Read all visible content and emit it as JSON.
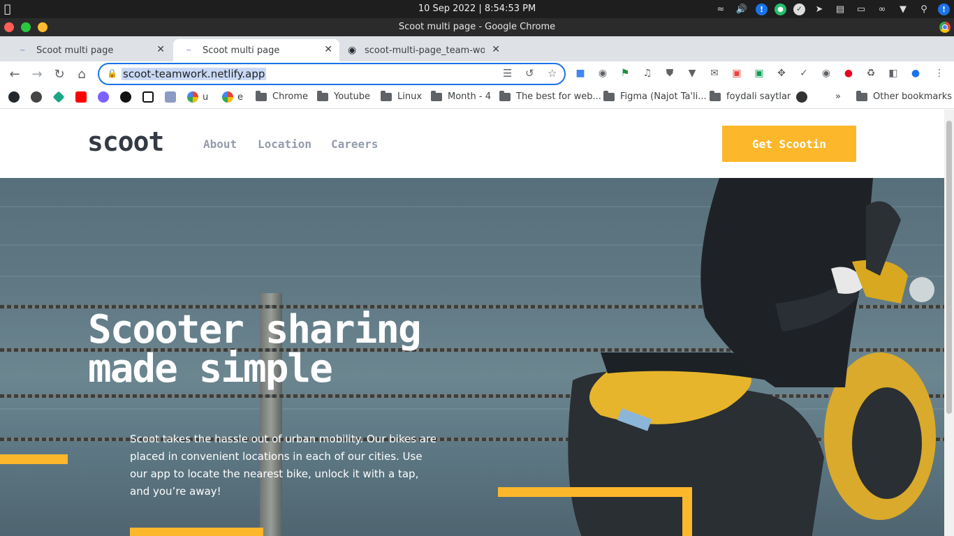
{
  "system": {
    "clock": "10 Sep 2022 | 8:54:53 PM",
    "apple_icon": "apple-icon",
    "tray_icons": [
      "wifi-icon",
      "volume-icon",
      "info-icon",
      "chat-icon",
      "check-icon",
      "send-icon",
      "clipboard-icon",
      "battery-icon",
      "bluetooth-icon",
      "chevron-down-icon",
      "search-icon",
      "info-icon"
    ]
  },
  "window": {
    "title": "Scoot multi page - Google Chrome"
  },
  "tabs": [
    {
      "label": "Scoot multi page",
      "active": false
    },
    {
      "label": "Scoot multi page",
      "active": true
    },
    {
      "label": "scoot-multi-page_team-work",
      "active": false
    }
  ],
  "omnibox": {
    "url": "scoot-teamwork.netlify.app"
  },
  "bookmarks": [
    {
      "label": "u"
    },
    {
      "label": "e"
    },
    {
      "label": "Chrome"
    },
    {
      "label": "Youtube"
    },
    {
      "label": "Linux"
    },
    {
      "label": "Month - 4"
    },
    {
      "label": "The best for web..."
    },
    {
      "label": "Figma (Najot Ta'li..."
    },
    {
      "label": "foydali saytlar"
    },
    {
      "label": "Other bookmarks"
    }
  ],
  "site": {
    "logo": "scoot",
    "nav": [
      "About",
      "Location",
      "Careers"
    ],
    "cta": "Get Scootin",
    "hero_title": "Scooter sharing made simple",
    "hero_text": "Scoot takes the hassle out of urban mobility. Our bikes are placed in convenient locations in each of our cities. Use our app to locate the nearest bike, unlock it with a tap, and you’re away!"
  },
  "colors": {
    "accent": "#fcb72b",
    "dark": "#333a44",
    "nav_grey": "#939cab",
    "omnibox_border": "#1a73e8"
  }
}
